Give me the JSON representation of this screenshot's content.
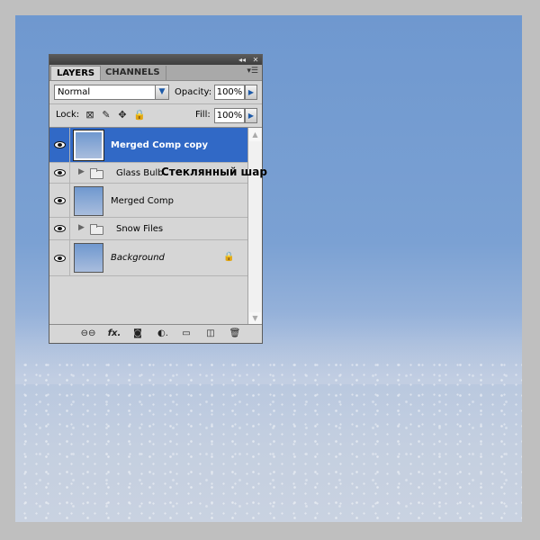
{
  "panel": {
    "tabs": [
      {
        "label": "LAYERS",
        "active": true
      },
      {
        "label": "CHANNELS",
        "active": false
      }
    ],
    "collapse_glyph": "◂◂",
    "close_glyph": "✕",
    "menu_glyph": "▾☰",
    "blend_mode": "Normal",
    "opacity_label": "Opacity:",
    "opacity_value": "100%",
    "lock_label": "Lock:",
    "fill_label": "Fill:",
    "fill_value": "100%"
  },
  "layers": [
    {
      "name": "Merged Comp copy",
      "type": "pixel",
      "selected": true
    },
    {
      "name": "Glass Bulb",
      "type": "group",
      "selected": false
    },
    {
      "name": "Merged Comp",
      "type": "pixel",
      "selected": false
    },
    {
      "name": "Snow Files",
      "type": "group",
      "selected": false
    },
    {
      "name": "Background",
      "type": "pixel",
      "selected": false,
      "locked": true
    }
  ],
  "overlay_caption": "Стеклянный шар",
  "footer_icons": [
    "link-icon",
    "fx-icon",
    "mask-icon",
    "adjustment-icon",
    "folder-icon",
    "new-layer-icon",
    "trash-icon"
  ],
  "footer_glyphs": {
    "link": "⊖⊖",
    "fx": "fx.",
    "mask": "◙",
    "adjust": "◐.",
    "folder": "▭",
    "new": "◫",
    "trash": "🗑"
  },
  "colors": {
    "selection": "#3169c6",
    "panel_bg": "#d6d6d6",
    "canvas_sky": "#6f98cf"
  }
}
